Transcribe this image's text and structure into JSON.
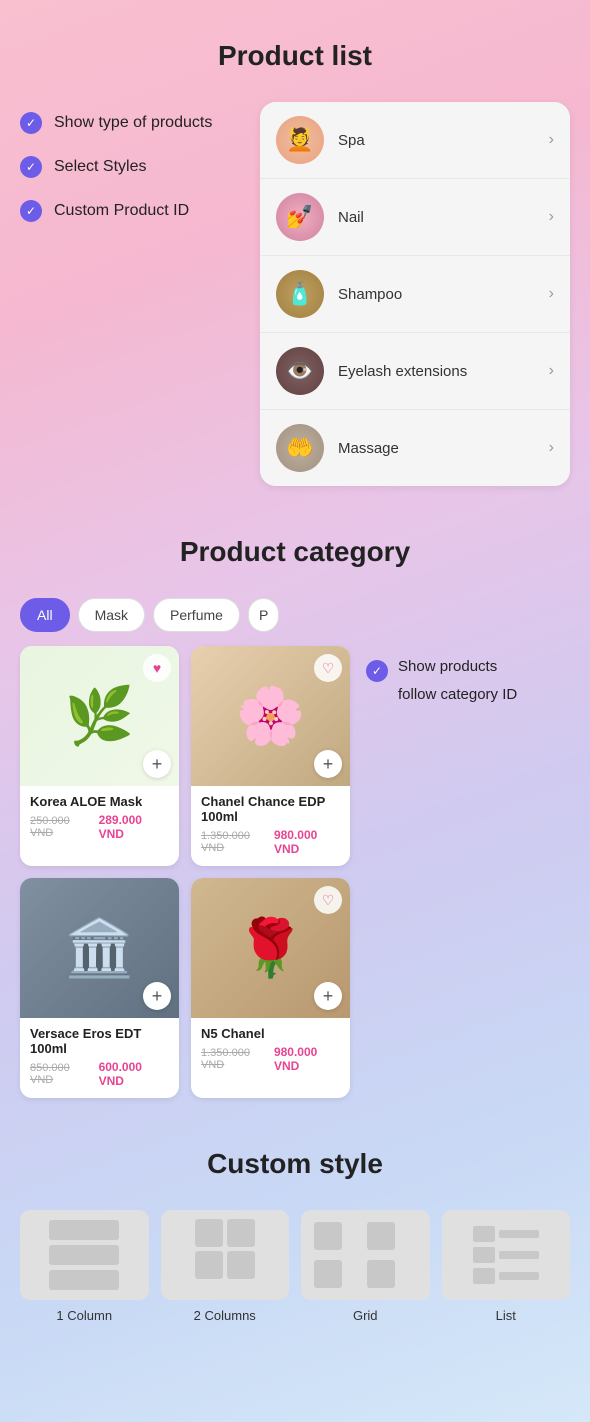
{
  "page": {
    "sections": {
      "product_list": {
        "title": "Product list",
        "features": [
          "Show type of products",
          "Select Styles",
          "Custom Product ID"
        ],
        "categories": [
          {
            "id": "spa",
            "name": "Spa",
            "emoji": "💆",
            "thumbClass": "thumb-spa"
          },
          {
            "id": "nail",
            "name": "Nail",
            "emoji": "💅",
            "thumbClass": "thumb-nail"
          },
          {
            "id": "shampoo",
            "name": "Shampoo",
            "emoji": "🧴",
            "thumbClass": "thumb-shampoo"
          },
          {
            "id": "eyelash",
            "name": "Eyelash extensions",
            "emoji": "👁️",
            "thumbClass": "thumb-eyelash"
          },
          {
            "id": "massage",
            "name": "Massage",
            "emoji": "🤲",
            "thumbClass": "thumb-massage"
          }
        ]
      },
      "product_category": {
        "title": "Product category",
        "tabs": [
          {
            "id": "all",
            "label": "All",
            "active": true
          },
          {
            "id": "mask",
            "label": "Mask",
            "active": false
          },
          {
            "id": "perfume",
            "label": "Perfume",
            "active": false
          },
          {
            "id": "more",
            "label": "P",
            "active": false
          }
        ],
        "products": [
          {
            "id": "korea-aloe",
            "name": "Korea ALOE Mask",
            "price_original": "250.000 VND",
            "price_sale": "289.000 VND",
            "bgClass": "aloe",
            "emoji": "🌿",
            "has_heart": true,
            "heart_active": true
          },
          {
            "id": "chanel-chance",
            "name": "Chanel Chance EDP 100ml",
            "price_original": "1.350.000 VND",
            "price_sale": "980.000 VND",
            "bgClass": "chanel",
            "emoji": "🌸",
            "has_heart": true,
            "heart_active": false
          },
          {
            "id": "versace-eros",
            "name": "Versace Eros EDT 100ml",
            "price_original": "850.000 VND",
            "price_sale": "600.000 VND",
            "bgClass": "versace",
            "emoji": "🏛️",
            "has_heart": false,
            "heart_active": false
          },
          {
            "id": "n5-chanel",
            "name": "N5 Chanel",
            "price_original": "1.350.000 VND",
            "price_sale": "980.000 VND",
            "bgClass": "n5",
            "emoji": "🌹",
            "has_heart": true,
            "heart_active": false
          }
        ],
        "right_features": {
          "label": "Show products",
          "sub_label": "follow category ID"
        }
      },
      "custom_style": {
        "title": "Custom style",
        "styles": [
          {
            "id": "1col",
            "label": "1 Column"
          },
          {
            "id": "2col",
            "label": "2 Columns"
          },
          {
            "id": "grid",
            "label": "Grid"
          },
          {
            "id": "list",
            "label": "List"
          }
        ]
      }
    }
  }
}
